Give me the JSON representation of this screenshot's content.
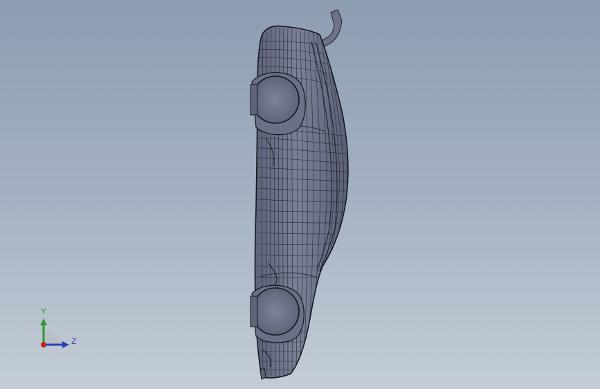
{
  "viewport": {
    "background_top": "#8d9db2",
    "background_bottom": "#c4cdd7",
    "model": {
      "kind": "car-body-wireframe",
      "view": "side",
      "shading_color": "#6b7186",
      "edge_color": "#1a1c24"
    }
  },
  "triad": {
    "y_label": "Y",
    "z_label": "Z",
    "y_color": "#2c9a2c",
    "z_color": "#2a3fb0",
    "x_color": "#c8201e",
    "icon": "axis-triad-icon"
  }
}
